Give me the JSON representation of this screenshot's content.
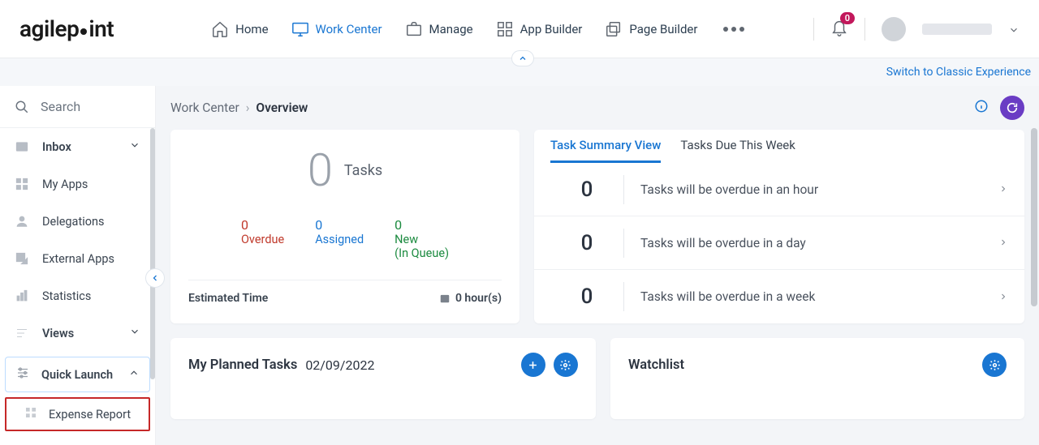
{
  "brand": "agilepoint",
  "nav": {
    "home": "Home",
    "work_center": "Work Center",
    "manage": "Manage",
    "app_builder": "App Builder",
    "page_builder": "Page Builder"
  },
  "notifications": {
    "count": "0"
  },
  "switch_link": "Switch to Classic Experience",
  "sidebar": {
    "search": "Search",
    "inbox": "Inbox",
    "my_apps": "My Apps",
    "delegations": "Delegations",
    "external_apps": "External Apps",
    "statistics": "Statistics",
    "views": "Views",
    "quick_launch": "Quick Launch",
    "expense_report": "Expense Report"
  },
  "breadcrumb": {
    "root": "Work Center",
    "current": "Overview"
  },
  "tasks_card": {
    "count": "0",
    "label": "Tasks",
    "overdue_n": "0",
    "overdue_l": "Overdue",
    "assigned_n": "0",
    "assigned_l": "Assigned",
    "new_n": "0",
    "new_l1": "New",
    "new_l2": "(In Queue)",
    "est_label": "Estimated Time",
    "est_value": "0 hour(s)"
  },
  "summary": {
    "tab_summary": "Task Summary View",
    "tab_due": "Tasks Due This Week",
    "rows": [
      {
        "count": "0",
        "text": "Tasks will be overdue in an hour"
      },
      {
        "count": "0",
        "text": "Tasks will be overdue in a day"
      },
      {
        "count": "0",
        "text": "Tasks will be overdue in a week"
      }
    ]
  },
  "planned": {
    "title": "My Planned Tasks",
    "date": "02/09/2022"
  },
  "watchlist": {
    "title": "Watchlist"
  }
}
